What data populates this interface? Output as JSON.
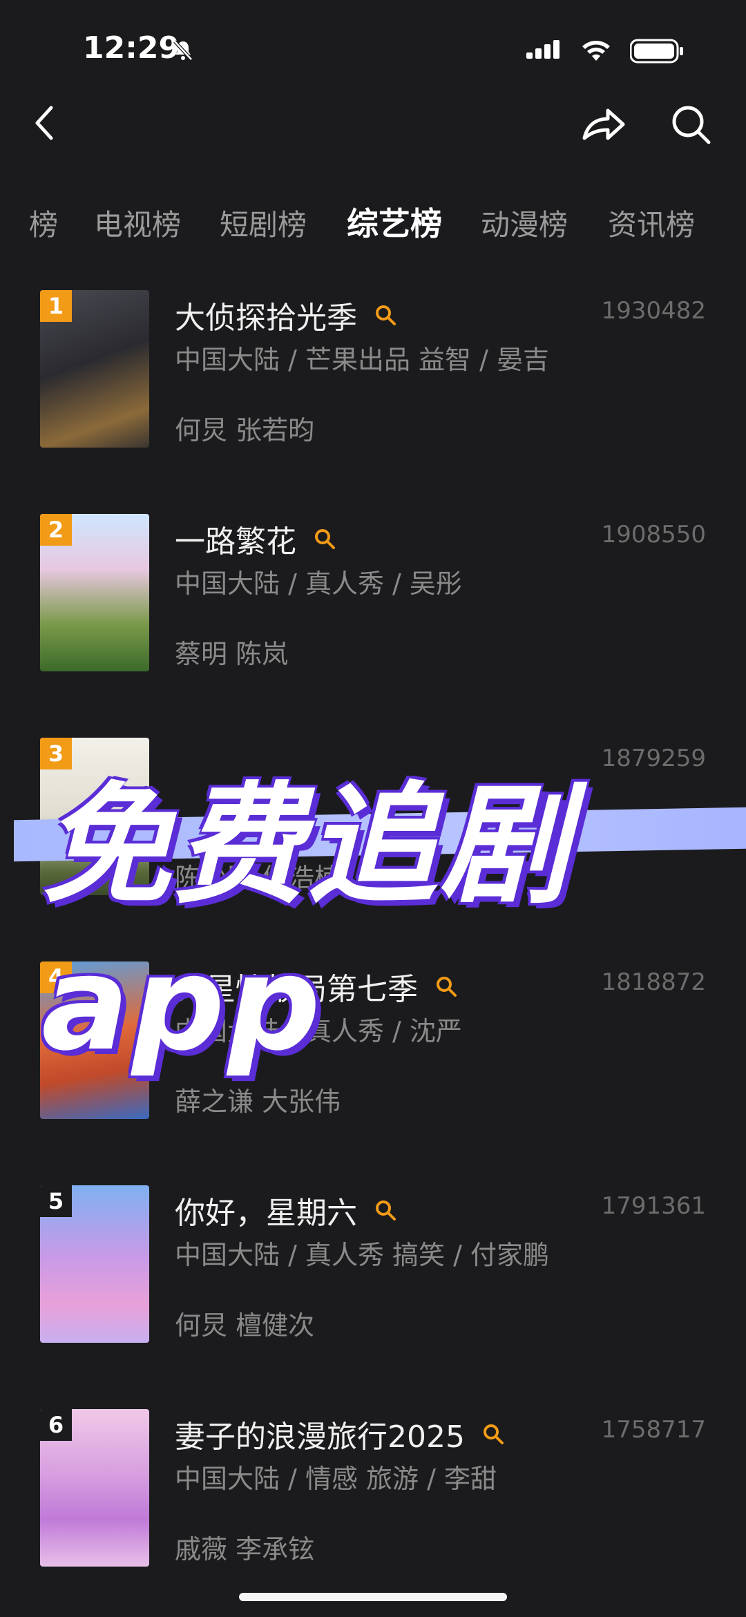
{
  "status": {
    "time": "12:29"
  },
  "tabs": [
    {
      "label": "榜",
      "active": false
    },
    {
      "label": "电视榜",
      "active": false
    },
    {
      "label": "短剧榜",
      "active": false
    },
    {
      "label": "综艺榜",
      "active": true
    },
    {
      "label": "动漫榜",
      "active": false
    },
    {
      "label": "资讯榜",
      "active": false
    }
  ],
  "items": [
    {
      "rank": "1",
      "title": "大侦探拾光季",
      "meta": "中国大陆 / 芒果出品 益智 / 晏吉",
      "cast": "何炅 张若昀",
      "score": "1930482",
      "search_icon": "search-icon"
    },
    {
      "rank": "2",
      "title": "一路繁花",
      "meta": "中国大陆 / 真人秀 / 吴彤",
      "cast": "蔡明 陈岚",
      "score": "1908550",
      "search_icon": "search-icon"
    },
    {
      "rank": "3",
      "title": "",
      "meta": "",
      "cast": "陈少熙 何浩楠",
      "score": "1879259",
      "search_icon": "search-icon"
    },
    {
      "rank": "4",
      "title": "火星情报局第七季",
      "meta": "中国大陆 / 真人秀 / 沈严",
      "cast": "薛之谦 大张伟",
      "score": "1818872",
      "search_icon": "search-icon"
    },
    {
      "rank": "5",
      "title": "你好，星期六",
      "meta": "中国大陆 / 真人秀 搞笑 / 付家鹏",
      "cast": "何炅 檀健次",
      "score": "1791361",
      "search_icon": "search-icon"
    },
    {
      "rank": "6",
      "title": "妻子的浪漫旅行2025",
      "meta": "中国大陆 / 情感 旅游 / 李甜",
      "cast": "戚薇 李承铉",
      "score": "1758717",
      "search_icon": "search-icon"
    }
  ],
  "overlay": {
    "text": "免费追剧app"
  },
  "colors": {
    "accent": "#f29b17",
    "overlay_stroke": "#5a2dd6",
    "background": "#1b1b1d"
  }
}
